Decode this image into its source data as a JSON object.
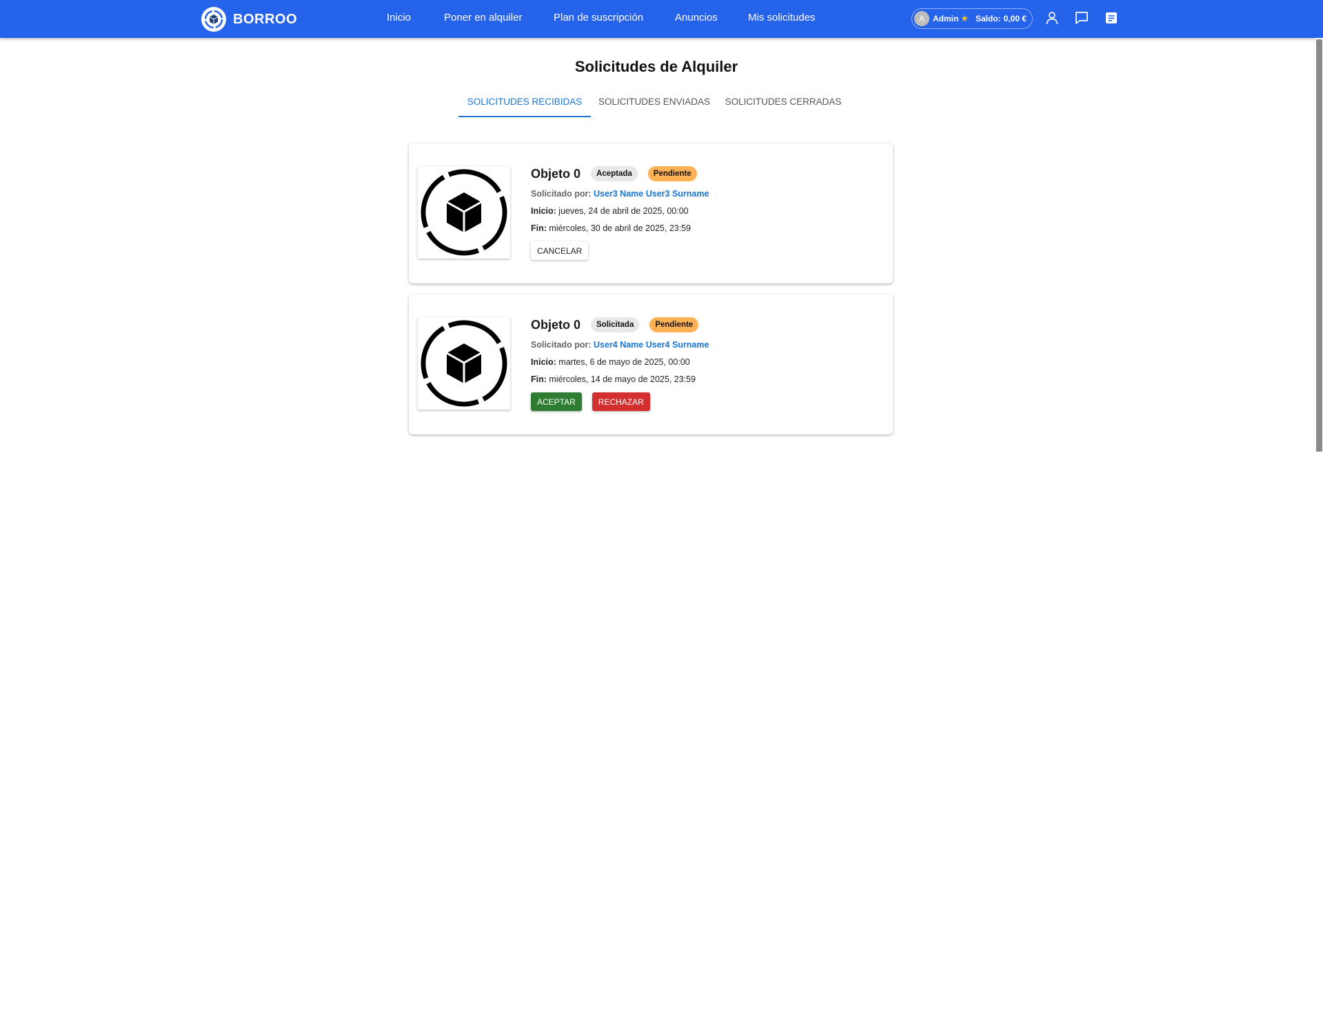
{
  "app": {
    "brand": "BORROO",
    "nav": [
      "Inicio",
      "Poner en alquiler",
      "Plan de suscripción",
      "Anuncios",
      "Mis solicitudes"
    ],
    "user": {
      "avatar_letter": "A",
      "name": "Admin",
      "balance_label": "Saldo:",
      "balance_value": "0,00 €"
    },
    "icons": [
      "profile-icon",
      "chat-icon",
      "notes-icon"
    ]
  },
  "page": {
    "title": "Solicitudes de Alquiler",
    "tabs": [
      "SOLICITUDES RECIBIDAS",
      "SOLICITUDES ENVIADAS",
      "SOLICITUDES CERRADAS"
    ],
    "active_tab": 0
  },
  "requests": [
    {
      "title": "Objeto 0",
      "status": "Aceptada",
      "payment": "Pendiente",
      "requested_by_label": "Solicitado por:",
      "requested_by": "User3 Name User3 Surname",
      "start_label": "Inicio:",
      "start": "jueves, 24 de abril de 2025, 00:00",
      "end_label": "Fin:",
      "end": "miércoles, 30 de abril de 2025, 23:59",
      "actions": [
        "CANCELAR"
      ]
    },
    {
      "title": "Objeto 0",
      "status": "Solicitada",
      "payment": "Pendiente",
      "requested_by_label": "Solicitado por:",
      "requested_by": "User4 Name User4 Surname",
      "start_label": "Inicio:",
      "start": "martes, 6 de mayo de 2025, 00:00",
      "end_label": "Fin:",
      "end": "miércoles, 14 de mayo de 2025, 23:59",
      "actions": [
        "ACEPTAR",
        "RECHAZAR"
      ]
    }
  ],
  "colors": {
    "topbar": "#2563eb",
    "accent": "#1976d2",
    "accept": "#2e7d32",
    "reject": "#d32f2f",
    "pending_chip": "#ffb155",
    "status_chip": "#e8e8e8"
  }
}
